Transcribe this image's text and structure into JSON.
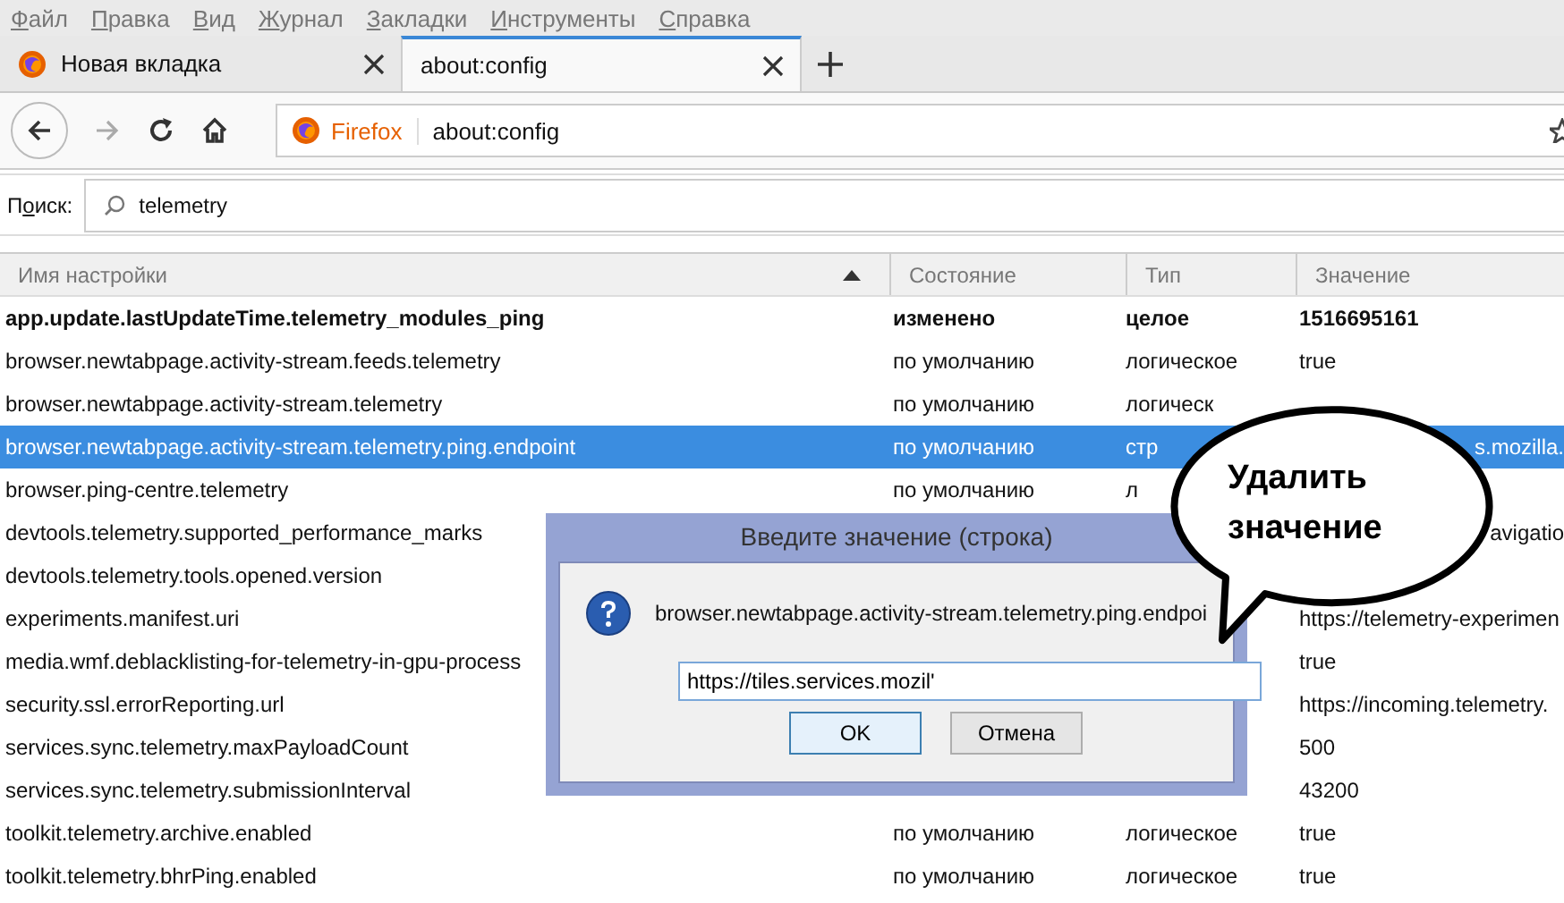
{
  "menu": [
    {
      "label_parts": [
        {
          "text": "Ф",
          "underlined": true
        },
        {
          "text": "айл",
          "underlined": false
        }
      ]
    },
    {
      "label_parts": [
        {
          "text": "П",
          "underlined": true
        },
        {
          "text": "равка",
          "underlined": false
        }
      ]
    },
    {
      "label_parts": [
        {
          "text": "В",
          "underlined": true
        },
        {
          "text": "ид",
          "underlined": false
        }
      ]
    },
    {
      "label_parts": [
        {
          "text": "Ж",
          "underlined": true
        },
        {
          "text": "урнал",
          "underlined": false
        }
      ]
    },
    {
      "label_parts": [
        {
          "text": "З",
          "underlined": true
        },
        {
          "text": "акладки",
          "underlined": false
        }
      ]
    },
    {
      "label_parts": [
        {
          "text": "И",
          "underlined": true
        },
        {
          "text": "нструменты",
          "underlined": false
        }
      ]
    },
    {
      "label_parts": [
        {
          "text": "С",
          "underlined": true
        },
        {
          "text": "правка",
          "underlined": false
        }
      ]
    }
  ],
  "tabs": [
    {
      "label": "Новая вкладка",
      "selected": false
    },
    {
      "label": "about:config",
      "selected": true
    }
  ],
  "url_bar": {
    "identity": "Firefox",
    "url": "about:config"
  },
  "search": {
    "label_parts": [
      {
        "text": "П",
        "underlined": false
      },
      {
        "text": "о",
        "underlined": true
      },
      {
        "text": "иск:",
        "underlined": false
      }
    ],
    "value": "telemetry"
  },
  "table": {
    "columns": [
      {
        "label": "Имя настройки",
        "sorted": true
      },
      {
        "label": "Состояние",
        "sorted": false
      },
      {
        "label": "Тип",
        "sorted": false
      },
      {
        "label": "Значение",
        "sorted": false
      }
    ],
    "rows": [
      {
        "name": "app.update.lastUpdateTime.telemetry_modules_ping",
        "state": "изменено",
        "type": "целое",
        "value": "1516695161",
        "modified": true,
        "selected": false
      },
      {
        "name": "browser.newtabpage.activity-stream.feeds.telemetry",
        "state": "по умолчанию",
        "type": "логическое",
        "value": "true",
        "modified": false,
        "selected": false
      },
      {
        "name": "browser.newtabpage.activity-stream.telemetry",
        "state": "по умолчанию",
        "type": "логическ",
        "modified": false,
        "selected": false
      },
      {
        "name": "browser.newtabpage.activity-stream.telemetry.ping.endpoint",
        "state": "по умолчанию",
        "type": "стр",
        "value": "s.mozilla.",
        "value_start_hidden": true,
        "modified": false,
        "selected": true
      },
      {
        "name": "browser.ping-centre.telemetry",
        "state": "по умолчанию",
        "type": "л",
        "modified": false,
        "selected": false
      },
      {
        "name": "devtools.telemetry.supported_performance_marks",
        "value": "avigatio",
        "value_start_hidden": true,
        "modified": false,
        "selected": false
      },
      {
        "name": "devtools.telemetry.tools.opened.version",
        "modified": false,
        "selected": false
      },
      {
        "name": "experiments.manifest.uri",
        "value": "https://telemetry-experimen",
        "modified": false,
        "selected": false
      },
      {
        "name": "media.wmf.deblacklisting-for-telemetry-in-gpu-process",
        "value": "true",
        "modified": false,
        "selected": false
      },
      {
        "name": "security.ssl.errorReporting.url",
        "value": "https://incoming.telemetry.",
        "modified": false,
        "selected": false
      },
      {
        "name": "services.sync.telemetry.maxPayloadCount",
        "value": "500",
        "modified": false,
        "selected": false
      },
      {
        "name": "services.sync.telemetry.submissionInterval",
        "value": "43200",
        "modified": false,
        "selected": false
      },
      {
        "name": "toolkit.telemetry.archive.enabled",
        "state": "по умолчанию",
        "type": "логическое",
        "value": "true",
        "modified": false,
        "selected": false
      },
      {
        "name": "toolkit.telemetry.bhrPing.enabled",
        "state": "по умолчанию",
        "type": "логическое",
        "value": "true",
        "modified": false,
        "selected": false
      }
    ]
  },
  "dialog": {
    "title": "Введите значение (строка)",
    "message": "browser.newtabpage.activity-stream.telemetry.ping.endpoi",
    "value": "https://tiles.services.mozil'",
    "buttons": [
      {
        "label": "OK",
        "default": true
      },
      {
        "label": "Отмена",
        "default": false
      }
    ]
  },
  "callout": {
    "lines": [
      "Удалить",
      "значение"
    ]
  }
}
